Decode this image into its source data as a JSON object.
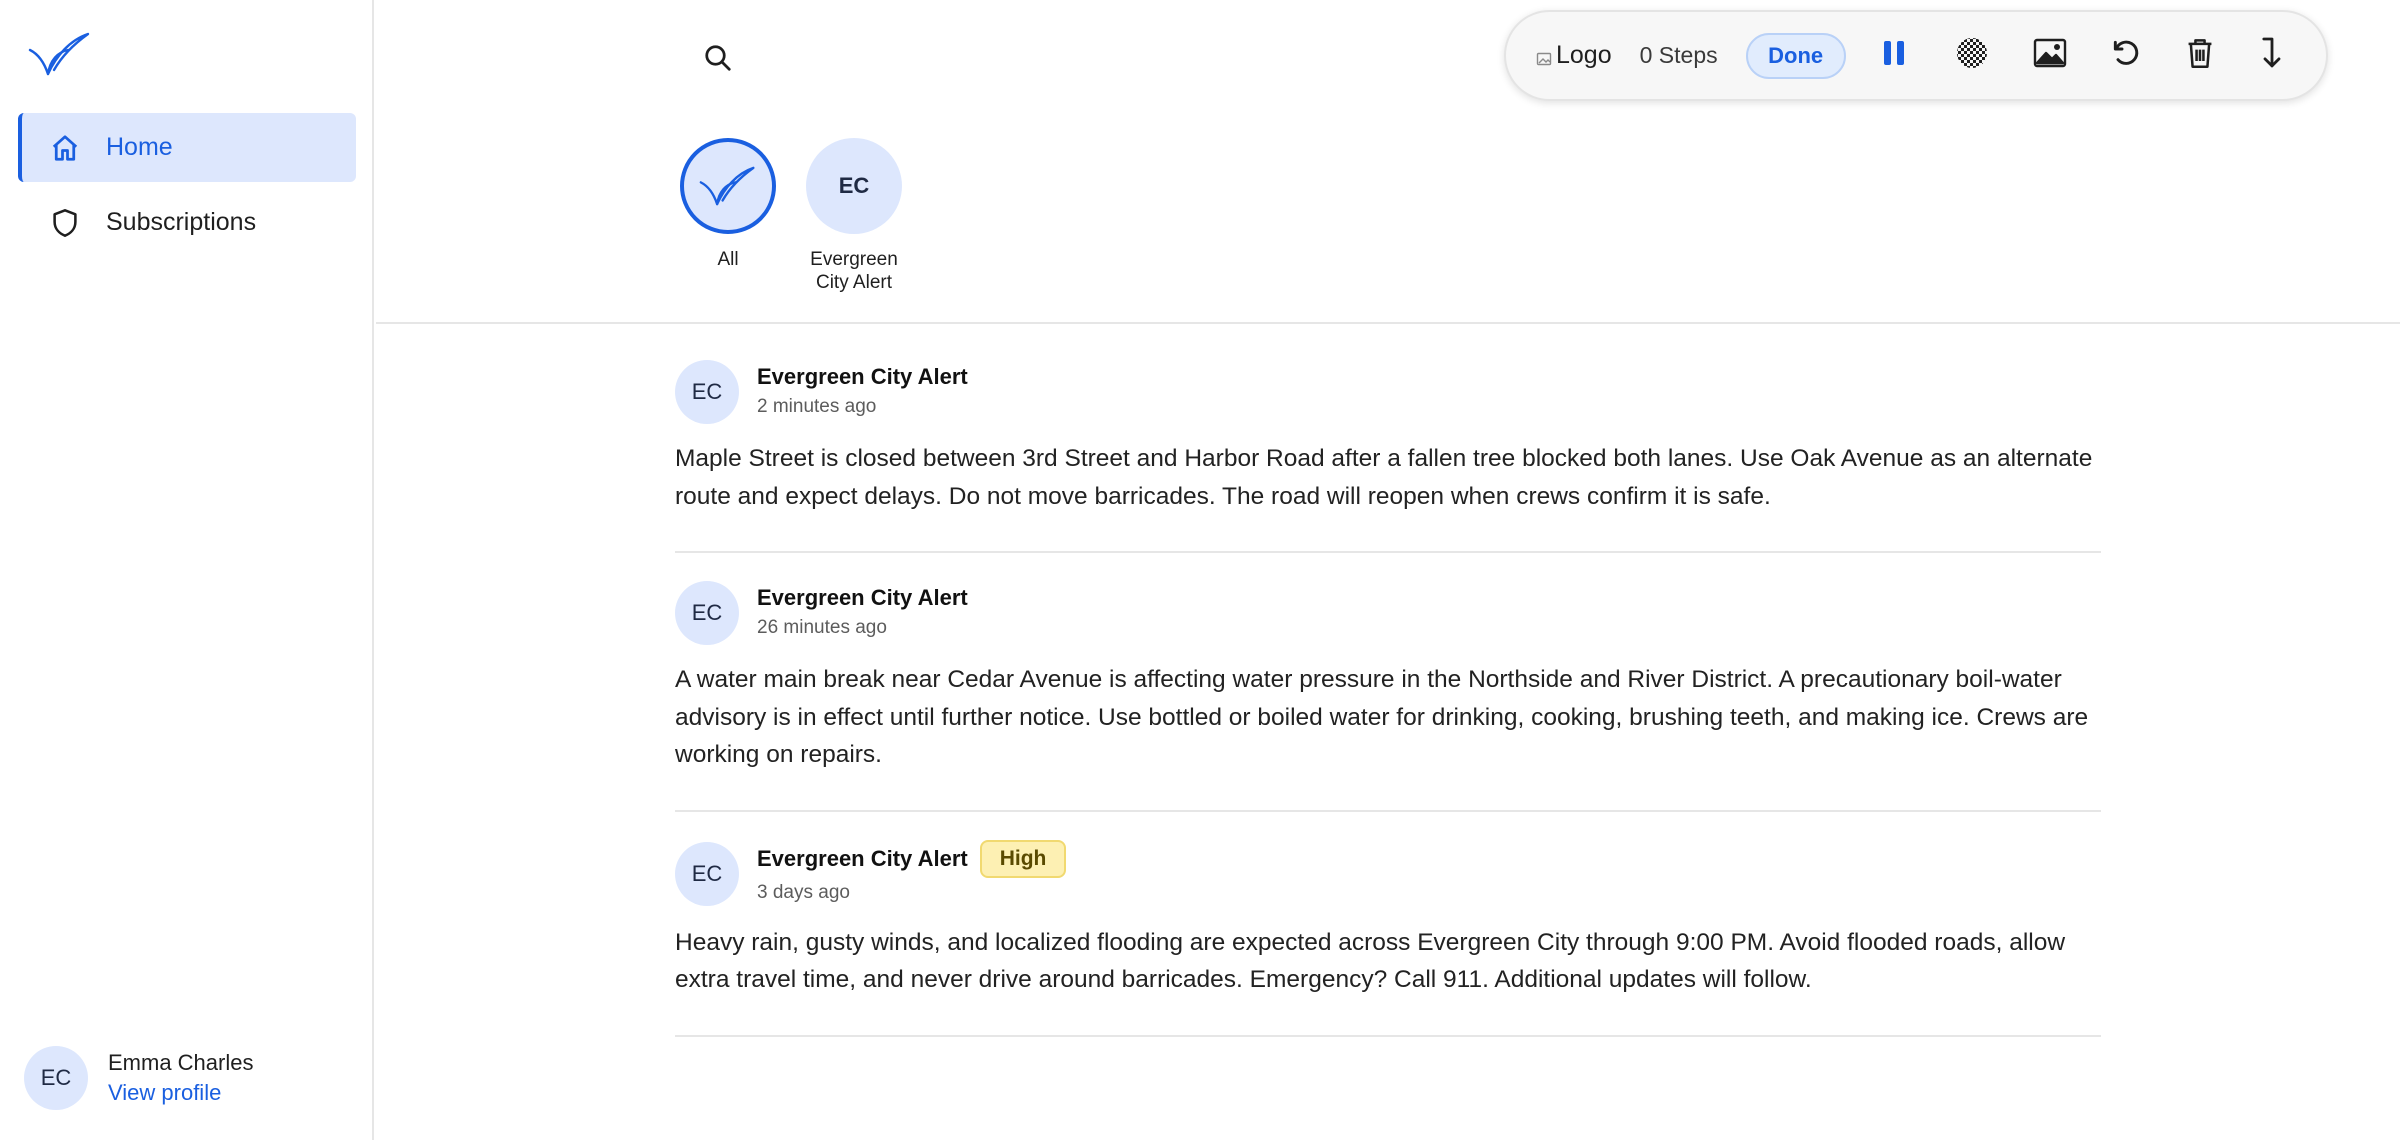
{
  "sidebar": {
    "items": [
      {
        "label": "Home",
        "icon": "home-icon",
        "active": true
      },
      {
        "label": "Subscriptions",
        "icon": "shield-icon",
        "active": false
      }
    ],
    "profile": {
      "initials": "EC",
      "name": "Emma Charles",
      "link": "View profile"
    }
  },
  "toolbar": {
    "logo_alt": "Logo",
    "steps": "0 Steps",
    "done_label": "Done",
    "icons": [
      "pause-icon",
      "checker-icon",
      "image-icon",
      "undo-icon",
      "trash-icon",
      "arrow-down-icon"
    ]
  },
  "filters": [
    {
      "label": "All",
      "selected": true
    },
    {
      "initials": "EC",
      "label": "Evergreen City Alert",
      "selected": false
    }
  ],
  "posts": [
    {
      "initials": "EC",
      "author": "Evergreen City Alert",
      "time": "2 minutes ago",
      "badge": "",
      "body": "Maple Street is closed between 3rd Street and Harbor Road after a fallen tree blocked both lanes. Use Oak Avenue as an alternate route and expect delays. Do not move barricades. The road will reopen when crews confirm it is safe."
    },
    {
      "initials": "EC",
      "author": "Evergreen City Alert",
      "time": "26 minutes ago",
      "badge": "",
      "body": "A water main break near Cedar Avenue is affecting water pressure in the Northside and River District. A precautionary boil-water advisory is in effect until further notice. Use bottled or boiled water for drinking, cooking, brushing teeth, and making ice. Crews are working on repairs."
    },
    {
      "initials": "EC",
      "author": "Evergreen City Alert",
      "time": "3 days ago",
      "badge": "High",
      "body": "Heavy rain, gusty winds, and localized flooding are expected across Evergreen City through 9:00 PM. Avoid flooded roads, allow extra travel time, and never drive around barricades. Emergency? Call 911. Additional updates will follow."
    }
  ],
  "colors": {
    "accent": "#1a5fe0",
    "accent_light": "#dde7fd",
    "badge_bg": "#fdf0b3"
  }
}
